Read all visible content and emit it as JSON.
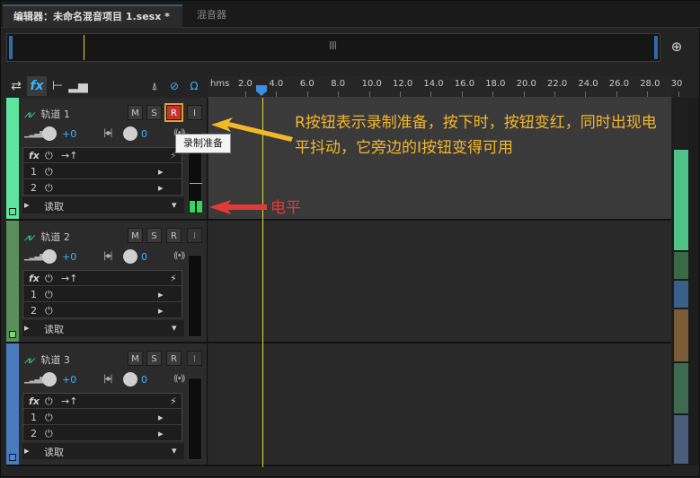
{
  "tabs": {
    "editor": "编辑器：未命名混音项目 1.sesx *",
    "mixer": "混音器"
  },
  "toolbar": {
    "icons": [
      "swap-icon",
      "fx-icon",
      "sends-icon",
      "eq-icon"
    ]
  },
  "ruler": {
    "unit": "hms",
    "labels": [
      "2.0",
      "4.0",
      "6.0",
      "8.0",
      "10.0",
      "12.0",
      "14.0",
      "16.0",
      "18.0",
      "20.0",
      "22.0",
      "24.0",
      "26.0",
      "28.0",
      "30"
    ]
  },
  "tracks": [
    {
      "name": "轨道 1",
      "color": "#5ee6a0",
      "armed": true,
      "volume": "+0",
      "pan": "0",
      "fx_slots": [
        "1",
        "2"
      ],
      "read_mode": "读取"
    },
    {
      "name": "轨道 2",
      "color": "#5a8f5a",
      "armed": false,
      "volume": "+0",
      "pan": "0",
      "fx_slots": [
        "1",
        "2"
      ],
      "read_mode": "读取"
    },
    {
      "name": "轨道 3",
      "color": "#4a7bbf",
      "armed": false,
      "volume": "+0",
      "pan": "0",
      "fx_slots": [
        "1",
        "2"
      ],
      "read_mode": "读取"
    }
  ],
  "buttons": {
    "mute": "M",
    "solo": "S",
    "record": "R",
    "input": "I"
  },
  "tooltip": "录制准备",
  "annotations": {
    "record": "R按钮表示录制准备，按下时，按钮变红，同时出现电平抖动，它旁边的I按钮变得可用",
    "level": "电平"
  },
  "colors": {
    "accent": "#35b4ff",
    "playhead": "#e2d83a",
    "record": "#c8322d",
    "annotation": "#f3b72a",
    "annotation_red": "#e53935"
  }
}
